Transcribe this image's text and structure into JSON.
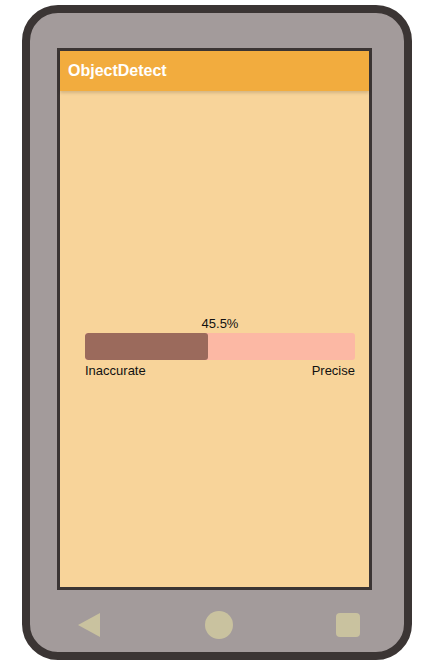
{
  "app_bar": {
    "title": "ObjectDetect"
  },
  "progress": {
    "reading": "45.5%",
    "level": 0.455,
    "min_label": "Inaccurate",
    "max_label": "Precise"
  }
}
